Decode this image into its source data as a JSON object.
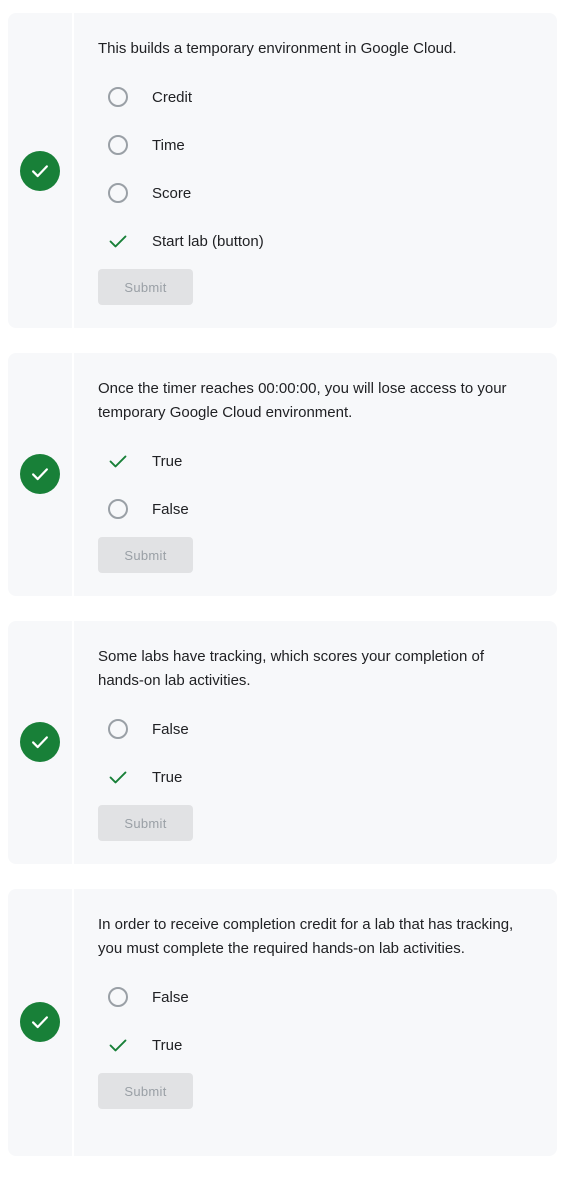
{
  "colors": {
    "correct_green": "#188038",
    "card_background": "#f7f8fa",
    "radio_border": "#9aa0a6",
    "submit_disabled_bg": "#e1e2e4",
    "submit_disabled_text": "#9aa0a6"
  },
  "questions": [
    {
      "text": "This builds a temporary environment in Google Cloud.",
      "status_icon": "check-circle-icon",
      "options": [
        {
          "label": "Credit",
          "state": "unselected"
        },
        {
          "label": "Time",
          "state": "unselected"
        },
        {
          "label": "Score",
          "state": "unselected"
        },
        {
          "label": "Start lab (button)",
          "state": "correct"
        }
      ],
      "submit_label": "Submit",
      "submit_disabled": true
    },
    {
      "text": "Once the timer reaches 00:00:00, you will lose access to your temporary Google Cloud environment.",
      "status_icon": "check-circle-icon",
      "options": [
        {
          "label": "True",
          "state": "correct"
        },
        {
          "label": "False",
          "state": "unselected"
        }
      ],
      "submit_label": "Submit",
      "submit_disabled": true
    },
    {
      "text": "Some labs have tracking, which scores your completion of hands-on lab activities.",
      "status_icon": "check-circle-icon",
      "options": [
        {
          "label": "False",
          "state": "unselected"
        },
        {
          "label": "True",
          "state": "correct"
        }
      ],
      "submit_label": "Submit",
      "submit_disabled": true
    },
    {
      "text": "In order to receive completion credit for a lab that has tracking, you must complete the required hands-on lab activities.",
      "status_icon": "check-circle-icon",
      "options": [
        {
          "label": "False",
          "state": "unselected"
        },
        {
          "label": "True",
          "state": "correct"
        }
      ],
      "submit_label": "Submit",
      "submit_disabled": true
    }
  ]
}
